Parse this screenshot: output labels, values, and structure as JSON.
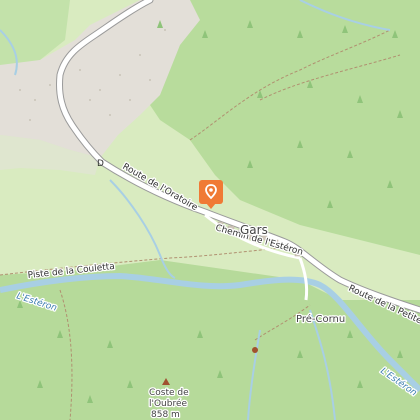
{
  "map": {
    "places": {
      "village": "Gars",
      "hamlet": "Pré-Cornu",
      "peak_name_1": "Coste de",
      "peak_name_2": "l'Oubrée",
      "peak_elevation": "858 m"
    },
    "roads": {
      "oratoire": "Route de l'Oratoire",
      "esteron_path": "Chemin de l'Estéron",
      "petite_foret": "Route de la Petite For",
      "couletta": "Piste de la Couletta"
    },
    "water": {
      "river_west": "L'Estéron",
      "river_east": "L'Estéron"
    },
    "road_ref": "D",
    "marker": {
      "icon": "map-pin-icon",
      "color": "#f07a35"
    }
  }
}
